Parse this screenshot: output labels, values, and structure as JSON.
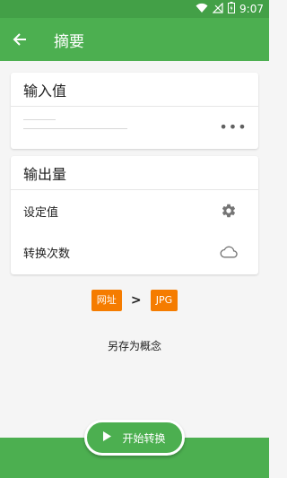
{
  "status_bar": {
    "time": "9:07"
  },
  "app_bar": {
    "back_icon": "arrow-back-icon",
    "title": "摘要"
  },
  "input_card": {
    "title": "输入值",
    "more_icon": "more-horizontal-icon",
    "more_glyph": "•••"
  },
  "output_card": {
    "title": "输出量",
    "options": [
      {
        "label": "设定值",
        "icon": "gear-icon"
      },
      {
        "label": "转换次数",
        "icon": "cloud-icon"
      }
    ]
  },
  "conversion": {
    "from": "网址",
    "arrow": ">",
    "to": "JPG"
  },
  "save_as": "另存为概念",
  "start_button": {
    "label": "开始转换",
    "icon": "play-icon"
  },
  "colors": {
    "primary": "#4caf50",
    "status": "#43a047",
    "accent": "#f57c00"
  }
}
